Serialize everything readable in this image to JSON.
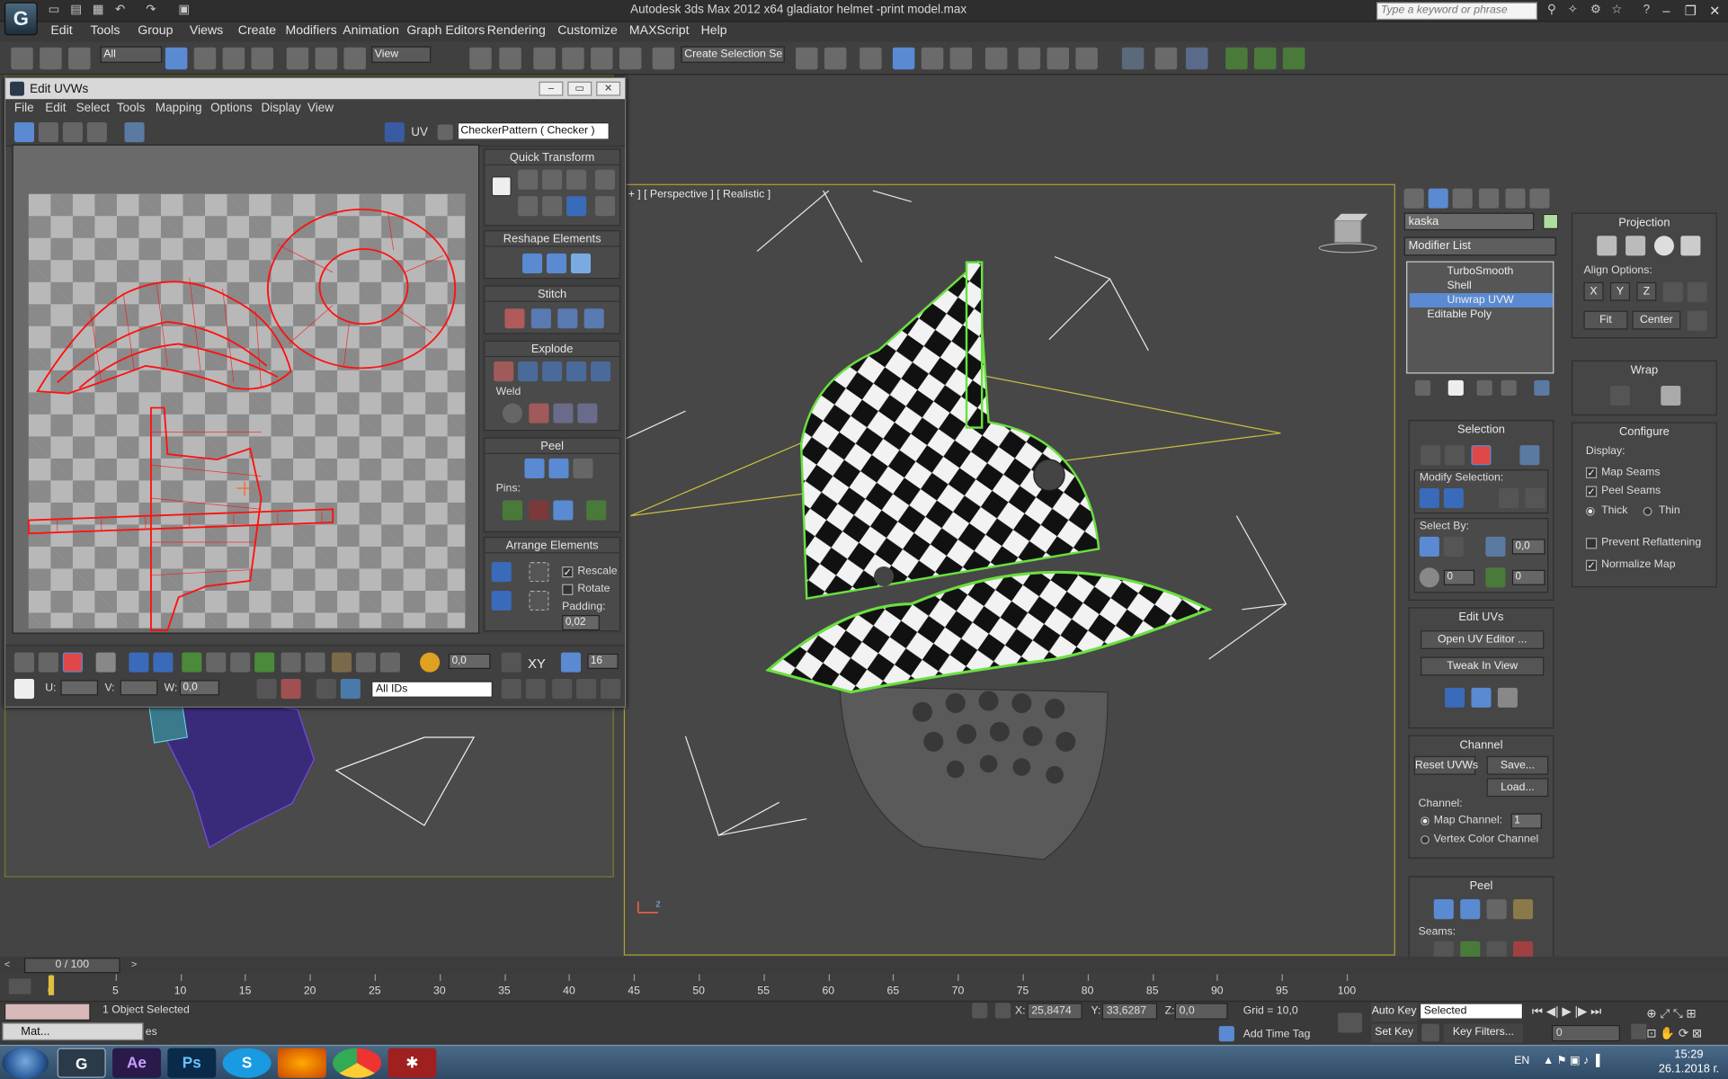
{
  "titlebar": {
    "title": "Autodesk 3ds Max  2012 x64     gladiator helmet -print model.max",
    "search_placeholder": "Type a keyword or phrase",
    "logo": "G"
  },
  "menubar": [
    "Edit",
    "Tools",
    "Group",
    "Views",
    "Create",
    "Modifiers",
    "Animation",
    "Graph Editors",
    "Rendering",
    "Customize",
    "MAXScript",
    "Help"
  ],
  "toolbar": {
    "selection_filter": "All",
    "ref_coord": "View",
    "named_selection": "Create Selection Se"
  },
  "uvw_editor": {
    "title": "Edit UVWs",
    "menus": [
      "File",
      "Edit",
      "Select",
      "Tools",
      "Mapping",
      "Options",
      "Display",
      "View"
    ],
    "uv_label": "UV",
    "texture_dropdown": "CheckerPattern  ( Checker )",
    "rollouts": {
      "quick_transform": "Quick Transform",
      "reshape": "Reshape Elements",
      "stitch": "Stitch",
      "explode": "Explode",
      "weld": "Weld",
      "peel": "Peel",
      "pins": "Pins:",
      "arrange": "Arrange Elements",
      "rescale": "Rescale",
      "rotate": "Rotate",
      "padding_label": "Padding:",
      "padding_value": "0,02"
    },
    "bottom": {
      "soft_value": "0,0",
      "xy": "XY",
      "count": "16",
      "u_label": "U:",
      "v_label": "V:",
      "w_label": "W:",
      "w_value": "0,0",
      "ids_dropdown": "All IDs"
    }
  },
  "viewport": {
    "label": "+ ] [ Perspective ] [ Realistic ]"
  },
  "command_panel": {
    "object_name": "kaska",
    "modifier_list": "Modifier List",
    "stack": [
      "TurboSmooth",
      "Shell",
      "Unwrap UVW",
      "Editable Poly"
    ],
    "selection": {
      "title": "Selection",
      "modify_selection": "Modify Selection:",
      "select_by": "Select By:",
      "spin1": "0,0",
      "spin2": "0",
      "spin3": "0"
    },
    "edit_uvs": {
      "title": "Edit UVs",
      "open_editor": "Open UV Editor ...",
      "tweak": "Tweak In View"
    },
    "channel": {
      "title": "Channel",
      "reset": "Reset UVWs",
      "save": "Save...",
      "load": "Load...",
      "channel_label": "Channel:",
      "map_channel": "Map Channel:",
      "map_channel_value": "1",
      "vertex_color": "Vertex Color Channel"
    },
    "peel": {
      "title": "Peel",
      "seams": "Seams:"
    },
    "projection": {
      "title": "Projection",
      "align_options": "Align Options:",
      "x": "X",
      "y": "Y",
      "z": "Z",
      "fit": "Fit",
      "center": "Center"
    },
    "wrap": {
      "title": "Wrap"
    },
    "configure": {
      "title": "Configure",
      "display": "Display:",
      "map_seams": "Map Seams",
      "peel_seams": "Peel Seams",
      "thick": "Thick",
      "thin": "Thin",
      "prevent_reflattening": "Prevent Reflattening",
      "normalize_map": "Normalize Map"
    }
  },
  "timeline": {
    "frame": "0 / 100",
    "ticks": [
      "0",
      "5",
      "10",
      "15",
      "20",
      "25",
      "30",
      "35",
      "40",
      "45",
      "50",
      "55",
      "60",
      "65",
      "70",
      "75",
      "80",
      "85",
      "90",
      "95",
      "100"
    ]
  },
  "status": {
    "selected": "1 Object Selected",
    "x_label": "X:",
    "x_value": "25,8474",
    "y_label": "Y:",
    "y_value": "33,6287",
    "z_label": "Z:",
    "z_value": "0,0",
    "grid": "Grid = 10,0",
    "add_time_tag": "Add Time Tag",
    "auto_key": "Auto Key",
    "set_key": "Set Key",
    "key_mode": "Selected",
    "key_filters": "Key Filters...",
    "frame_field": "0",
    "minimized": "Mat...",
    "prompt_tail": "es"
  },
  "taskbar": {
    "lang": "EN",
    "time": "15:29",
    "date": "26.1.2018 г.",
    "apps": [
      "3ds Max",
      "After Effects",
      "Photoshop",
      "Skype",
      "Firefox",
      "Chrome",
      "App"
    ]
  }
}
